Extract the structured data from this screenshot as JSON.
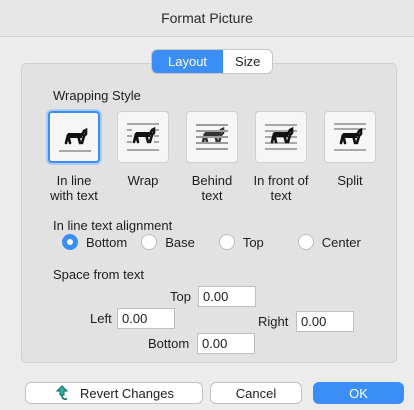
{
  "window": {
    "title": "Format Picture"
  },
  "tabs": [
    {
      "label": "Layout",
      "active": true
    },
    {
      "label": "Size",
      "active": false
    }
  ],
  "wrapping": {
    "heading": "Wrapping Style",
    "options": [
      {
        "line1": "In line",
        "line2": "with text",
        "icon": "inline-icon",
        "selected": true
      },
      {
        "line1": "Wrap",
        "line2": "",
        "icon": "wrap-icon",
        "selected": false
      },
      {
        "line1": "Behind",
        "line2": "text",
        "icon": "behind-text-icon",
        "selected": false
      },
      {
        "line1": "In front of",
        "line2": "text",
        "icon": "in-front-of-text-icon",
        "selected": false
      },
      {
        "line1": "Split",
        "line2": "",
        "icon": "split-icon",
        "selected": false
      }
    ]
  },
  "alignment": {
    "heading": "In line text alignment",
    "options": [
      {
        "label": "Bottom",
        "selected": true
      },
      {
        "label": "Base",
        "selected": false
      },
      {
        "label": "Top",
        "selected": false
      },
      {
        "label": "Center",
        "selected": false
      }
    ]
  },
  "spacing": {
    "heading": "Space from text",
    "top_label": "Top",
    "top_value": "0.00",
    "left_label": "Left",
    "left_value": "0.00",
    "right_label": "Right",
    "right_value": "0.00",
    "bottom_label": "Bottom",
    "bottom_value": "0.00"
  },
  "footer": {
    "revert_label": "Revert Changes",
    "cancel_label": "Cancel",
    "ok_label": "OK"
  },
  "colors": {
    "accent": "#3a8ef6",
    "background": "#ececec",
    "panel": "#e2e2e2"
  }
}
